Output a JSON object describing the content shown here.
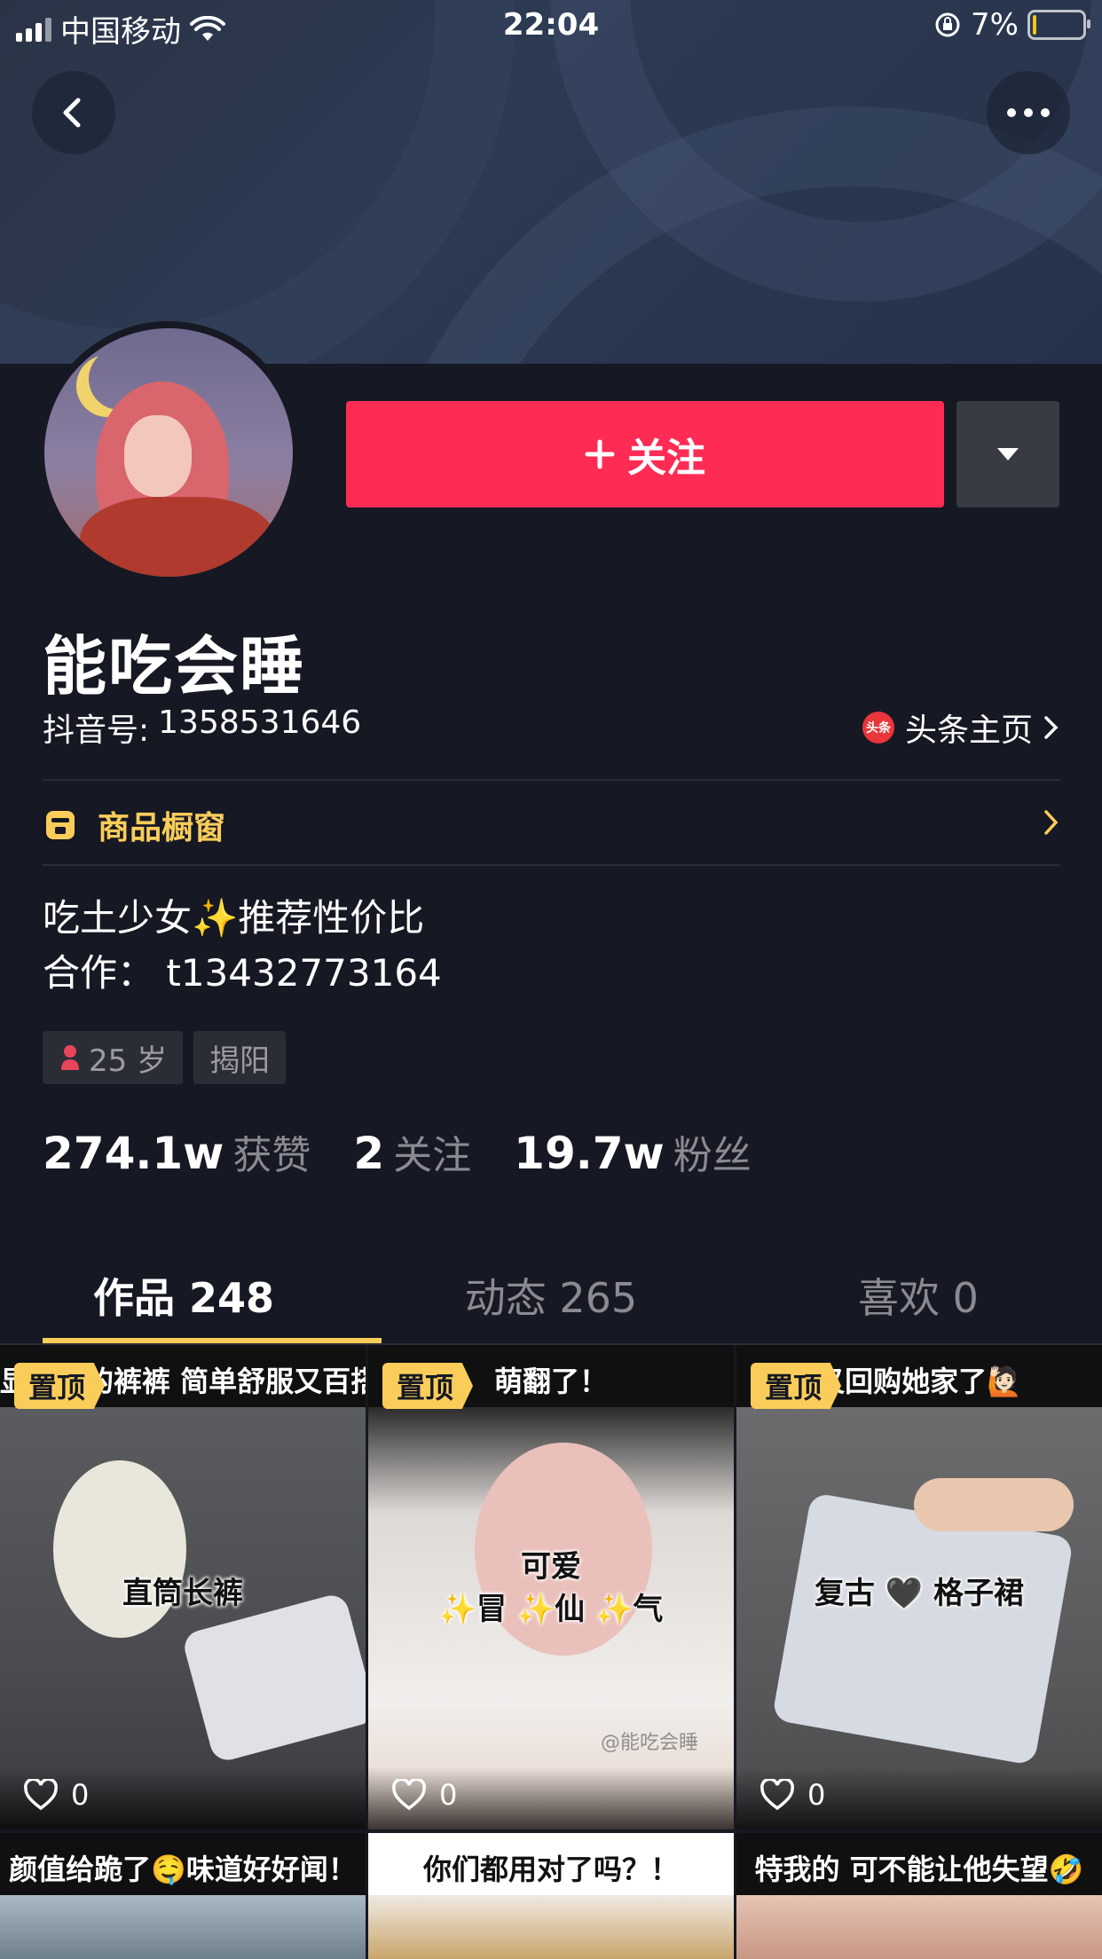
{
  "status": {
    "carrier": "中国移动",
    "time": "22:04",
    "battery": "7%"
  },
  "profile": {
    "name": "能吃会睡",
    "douyin_id_label": "抖音号:",
    "douyin_id": "1358531646",
    "toutiao_label": "头条主页",
    "toutiao_badge": "头条",
    "follow_label": "关注",
    "shop_label": "商品橱窗",
    "bio_line1": "吃土少女✨推荐性价比",
    "bio_line2": "合作：  t13432773164",
    "tags": {
      "age": "25 岁",
      "location": "揭阳"
    },
    "stats": {
      "likes_num": "274.1w",
      "likes_label": "获赞",
      "following_num": "2",
      "following_label": "关注",
      "fans_num": "19.7w",
      "fans_label": "粉丝"
    }
  },
  "tabs": {
    "works": "作品 248",
    "dynamics": "动态 265",
    "likes": "喜欢 0"
  },
  "videos": [
    {
      "caption": "显腿长的裤裤 简单舒服又百搭",
      "pin": "置顶",
      "overlay": "直筒长裤",
      "likes": "0"
    },
    {
      "caption": "萌翻了！",
      "pin": "置顶",
      "overlay1": "可爱",
      "overlay2": "✨冒 ✨仙 ✨气",
      "watermark": "@能吃会睡",
      "likes": "0"
    },
    {
      "caption": "又回购她家了🙋🏻",
      "pin": "置顶",
      "overlay": "复古 🖤 格子裙",
      "likes": "0"
    },
    {
      "caption": "颜值给跪了🤤味道好好闻！"
    },
    {
      "caption": "你们都用对了吗？！"
    },
    {
      "caption": "特我的 可不能让他失望🤣"
    }
  ],
  "colors": {
    "background": "#161823",
    "accent": "#fe2c55",
    "highlight": "#facd5a"
  },
  "icons": [
    "back-icon",
    "more-icon",
    "wifi-icon",
    "battery-icon",
    "caret-down-icon",
    "plus-icon",
    "shop-icon",
    "chevron-right-icon",
    "female-icon",
    "heart-icon"
  ]
}
